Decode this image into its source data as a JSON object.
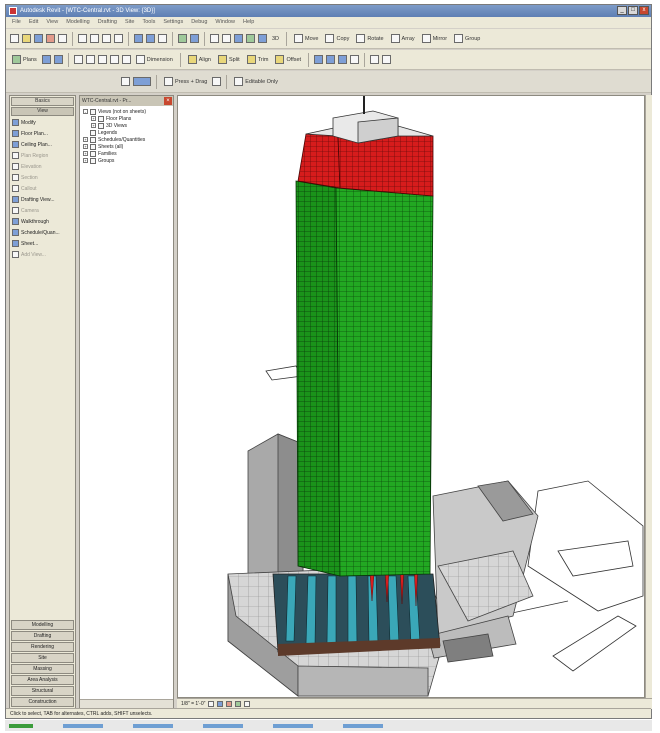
{
  "window": {
    "title": "Autodesk Revit - [WTC-Central.rvt - 3D View: {3D}]",
    "controls": [
      "_",
      "□",
      "x"
    ]
  },
  "menubar": [
    "File",
    "Edit",
    "View",
    "Modelling",
    "Drafting",
    "Site",
    "Tools",
    "Settings",
    "Debug",
    "Window",
    "Help"
  ],
  "toolbar1": {
    "right_tools": [
      "Move",
      "Copy",
      "Rotate",
      "Array",
      "Mirror",
      "Group"
    ],
    "view_label": "3D"
  },
  "toolbar2": {
    "tools": [
      "Plans",
      "Dimension",
      "Align",
      "Split",
      "Trim",
      "Offset"
    ]
  },
  "options_bar": {
    "press_drag": "Press + Drag",
    "editable_only": "Editable Only"
  },
  "left_panel": {
    "tabs_top": [
      "Basics",
      "View"
    ],
    "items": [
      {
        "label": "Modify",
        "icon": "cursor-icon",
        "enabled": true
      },
      {
        "label": "Floor Plan...",
        "icon": "floor-plan-icon",
        "enabled": true
      },
      {
        "label": "Ceiling Plan...",
        "icon": "ceiling-plan-icon",
        "enabled": true
      },
      {
        "label": "Plan Region",
        "icon": "plan-region-icon",
        "enabled": false
      },
      {
        "label": "Elevation",
        "icon": "elevation-icon",
        "enabled": false
      },
      {
        "label": "Section",
        "icon": "section-icon",
        "enabled": false
      },
      {
        "label": "Callout",
        "icon": "callout-icon",
        "enabled": false
      },
      {
        "label": "Drafting View...",
        "icon": "drafting-view-icon",
        "enabled": true
      },
      {
        "label": "Camera",
        "icon": "camera-icon",
        "enabled": false
      },
      {
        "label": "Walkthrough",
        "icon": "walkthrough-icon",
        "enabled": true
      },
      {
        "label": "Schedule/Quan...",
        "icon": "schedule-icon",
        "enabled": true
      },
      {
        "label": "Sheet...",
        "icon": "sheet-icon",
        "enabled": true
      },
      {
        "label": "Add View...",
        "icon": "add-view-icon",
        "enabled": false
      }
    ],
    "tabs_bottom": [
      "Modelling",
      "Drafting",
      "Rendering",
      "Site",
      "Massing",
      "Area Analysis",
      "Structural",
      "Construction"
    ]
  },
  "project_browser": {
    "title": "WTC-Central.rvt - Pr...",
    "tree": [
      {
        "label": "Views (not on sheets)",
        "level": 0,
        "expander": "-"
      },
      {
        "label": "Floor Plans",
        "level": 1,
        "expander": "+"
      },
      {
        "label": "3D Views",
        "level": 1,
        "expander": "+"
      },
      {
        "label": "Legends",
        "level": 0,
        "expander": ""
      },
      {
        "label": "Schedules/Quantities",
        "level": 0,
        "expander": "+"
      },
      {
        "label": "Sheets (all)",
        "level": 0,
        "expander": "+"
      },
      {
        "label": "Families",
        "level": 0,
        "expander": "+"
      },
      {
        "label": "Groups",
        "level": 0,
        "expander": "+"
      }
    ]
  },
  "view_control": {
    "scale": "1/8\" = 1'-0\""
  },
  "status": "Click to select, TAB for alternates, CTRL adds, SHIFT unselects.",
  "colors": {
    "tower_green": "#1fa51f",
    "tower_red": "#d81e1e",
    "podium_gray": "#a8a8a8",
    "titlebar": "#6d8cc0"
  }
}
